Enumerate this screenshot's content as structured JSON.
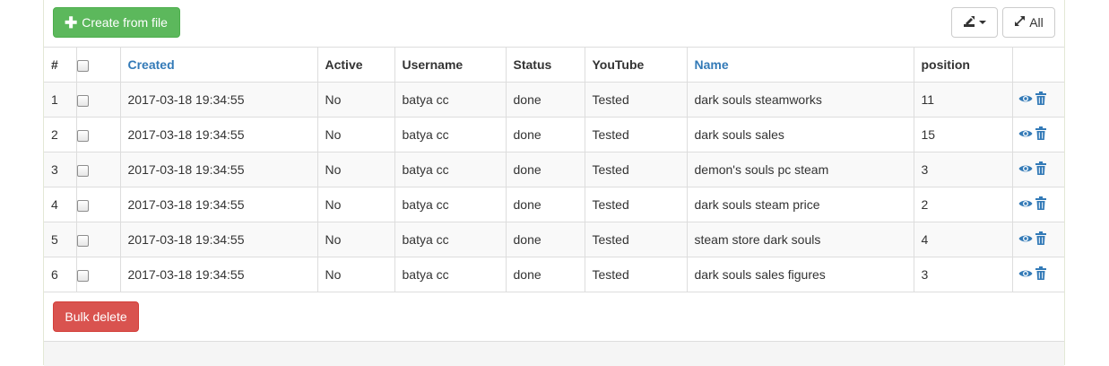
{
  "toolbar": {
    "create_label": "Create from file",
    "all_label": "All"
  },
  "table": {
    "headers": {
      "index": "#",
      "created": "Created",
      "active": "Active",
      "username": "Username",
      "status": "Status",
      "youtube": "YouTube",
      "name": "Name",
      "position": "position"
    },
    "sortable_link_color": "#337ab7",
    "rows": [
      {
        "index": "1",
        "created": "2017-03-18 19:34:55",
        "active": "No",
        "username": "batya cc",
        "status": "done",
        "youtube": "Tested",
        "name": "dark souls steamworks",
        "position": "11"
      },
      {
        "index": "2",
        "created": "2017-03-18 19:34:55",
        "active": "No",
        "username": "batya cc",
        "status": "done",
        "youtube": "Tested",
        "name": "dark souls sales",
        "position": "15"
      },
      {
        "index": "3",
        "created": "2017-03-18 19:34:55",
        "active": "No",
        "username": "batya cc",
        "status": "done",
        "youtube": "Tested",
        "name": "demon's souls pc steam",
        "position": "3"
      },
      {
        "index": "4",
        "created": "2017-03-18 19:34:55",
        "active": "No",
        "username": "batya cc",
        "status": "done",
        "youtube": "Tested",
        "name": "dark souls steam price",
        "position": "2"
      },
      {
        "index": "5",
        "created": "2017-03-18 19:34:55",
        "active": "No",
        "username": "batya cc",
        "status": "done",
        "youtube": "Tested",
        "name": "steam store dark souls",
        "position": "4"
      },
      {
        "index": "6",
        "created": "2017-03-18 19:34:55",
        "active": "No",
        "username": "batya cc",
        "status": "done",
        "youtube": "Tested",
        "name": "dark souls sales figures",
        "position": "3"
      }
    ],
    "row_actions": [
      "eye-icon",
      "trash-icon"
    ]
  },
  "bulk_delete_label": "Bulk delete",
  "colors": {
    "success": "#5cb85c",
    "danger": "#d9534f",
    "link": "#337ab7"
  }
}
